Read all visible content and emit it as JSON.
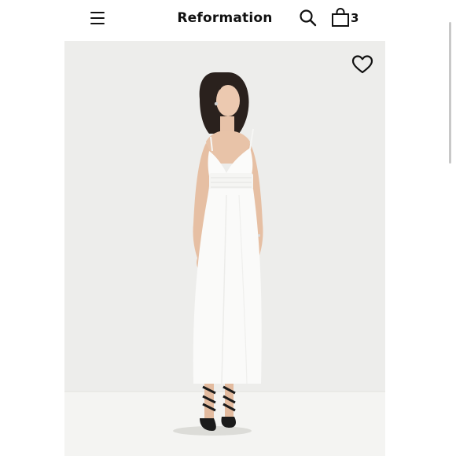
{
  "header": {
    "brand": "Reformation",
    "bag_count": "3",
    "icons": {
      "menu": "hamburger-menu-icon",
      "search": "search-icon",
      "bag": "shopping-bag-icon"
    }
  },
  "product": {
    "image": "white-midi-dress-on-model",
    "wishlist_icon": "heart-outline-icon"
  },
  "colors": {
    "background": "#ffffff",
    "image_backdrop": "#ededeb",
    "text": "#111111"
  }
}
